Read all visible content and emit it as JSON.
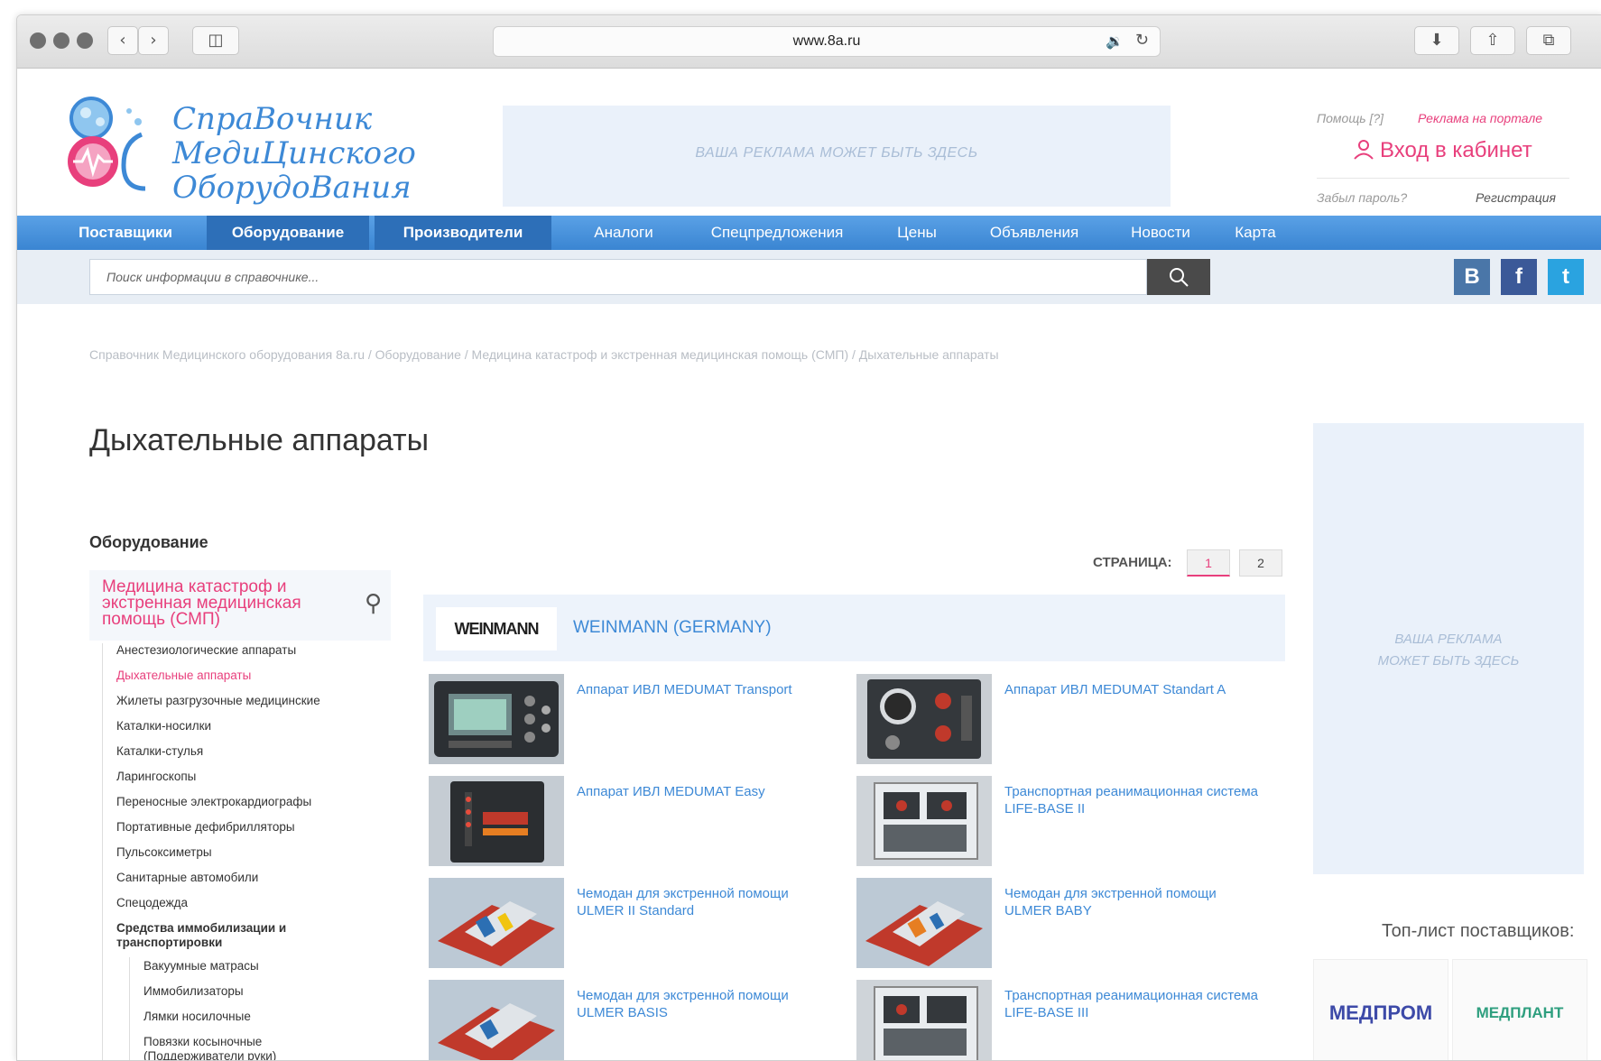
{
  "browser": {
    "url": "www.8a.ru"
  },
  "header": {
    "logo_lines": [
      "СпраВочник",
      "МедиЦинского",
      "ОборудоВания"
    ],
    "banner_text": "ВАША РЕКЛАМА МОЖЕТ БЫТЬ ЗДЕСЬ",
    "help_link": "Помощь [?]",
    "ad_link": "Реклама на портале",
    "login_label": "Вход в кабинет",
    "forgot_link": "Забыл пароль?",
    "register_link": "Регистрация"
  },
  "nav": {
    "items": [
      "Поставщики",
      "Оборудование",
      "Производители",
      "Аналоги",
      "Спецпредложения",
      "Цены",
      "Объявления",
      "Новости",
      "Карта"
    ]
  },
  "search": {
    "placeholder": "Поиск информации в справочнике..."
  },
  "social": {
    "vk": "В",
    "fb": "f",
    "tw": "t"
  },
  "breadcrumb": "Справочник Медицинского оборудования 8a.ru / Оборудование / Медицина катастроф и экстренная медицинская помощь (СМП) / Дыхательные аппараты",
  "page_title": "Дыхательные аппараты",
  "sidebar": {
    "title": "Оборудование",
    "category": "Медицина катастроф и экстренная медицинская помощь (СМП)",
    "items": [
      "Анестезиологические аппараты",
      "Дыхательные аппараты",
      "Жилеты разгрузочные медицинские",
      "Каталки-носилки",
      "Каталки-стулья",
      "Ларингоскопы",
      "Переносные электрокардиографы",
      "Портативные дефибрилляторы",
      "Пульсоксиметры",
      "Санитарные автомобили",
      "Спецодежда",
      "Средства иммобилизации и транспортировки"
    ],
    "subitems": [
      "Вакуумные матрасы",
      "Иммобилизаторы",
      "Лямки носилочные",
      "Повязки косыночные (Поддерживатели руки)"
    ]
  },
  "pager": {
    "label": "СТРАНИЦА:",
    "pages": [
      "1",
      "2"
    ]
  },
  "manufacturer": {
    "logo_text": "WEINMANN",
    "name": "WEINMANN (GERMANY)"
  },
  "products": [
    "Аппарат ИВЛ MEDUMAT Transport",
    "Аппарат ИВЛ MEDUMAT Standart A",
    "Аппарат ИВЛ MEDUMAT Easy",
    "Транспортная реанимационная система LIFE-BASE II",
    "Чемодан для экстренной помощи ULMER II Standard",
    "Чемодан для экстренной помощи ULMER BABY",
    "Чемодан для экстренной помощи ULMER BASIS",
    "Транспортная реанимационная система LIFE-BASE III"
  ],
  "right_ad": {
    "line1": "ВАША РЕКЛАМА",
    "line2": "МОЖЕТ БЫТЬ ЗДЕСЬ"
  },
  "top_list": {
    "title": "Топ-лист поставщиков:",
    "suppliers": [
      "МЕДПРОМ",
      "МЕДПЛАНТ"
    ]
  },
  "colors": {
    "accent_blue": "#3d89d6",
    "accent_pink": "#e83f7c",
    "nav_blue": "#4a93dc"
  }
}
